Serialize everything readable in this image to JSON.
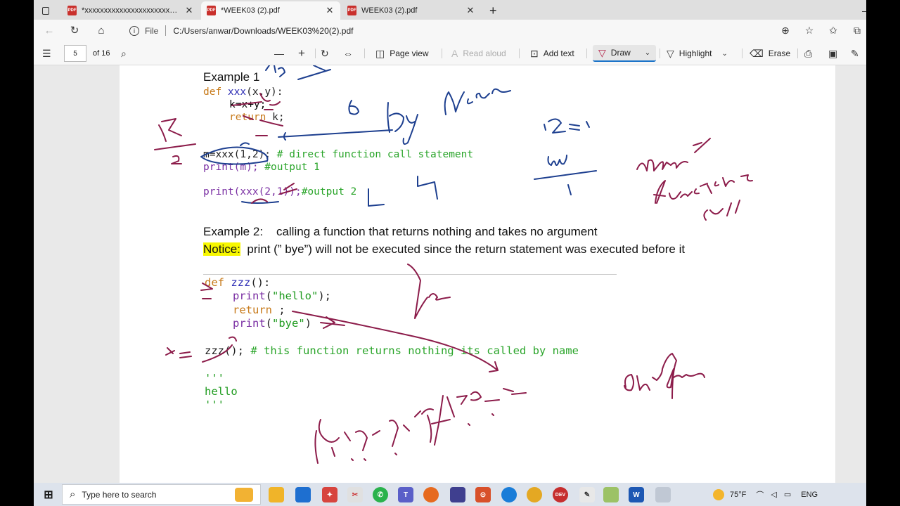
{
  "tabs": [
    {
      "title": "*xxxxxxxxxxxxxxxxxxxxxxxxxxxx.pdf",
      "icon": "pdf-icon",
      "active": false
    },
    {
      "title": "*WEEK03 (2).pdf",
      "icon": "pdf-icon",
      "active": true
    },
    {
      "title": "WEEK03 (2).pdf",
      "icon": "pdf-icon",
      "active": false
    }
  ],
  "address": {
    "file_label": "File",
    "url": "C:/Users/anwar/Downloads/WEEK03%20(2).pdf"
  },
  "toolbar": {
    "page_number": "5",
    "page_total": "of 16",
    "page_view": "Page view",
    "read_aloud": "Read aloud",
    "add_text": "Add text",
    "draw": "Draw",
    "highlight": "Highlight",
    "erase": "Erase"
  },
  "document": {
    "example1_title": "Example 1",
    "ex1_code": {
      "l1_def": "def",
      "l1_name": " xxx",
      "l1_rest": "(x,y):",
      "l2": "k=x+y;",
      "l3_kw": "return",
      "l3_rest": " k;",
      "l4_code": "m=xxx(1,2);",
      "l4_comment": " # direct function call statement",
      "l5_code": "print(m);",
      "l5_comment": " #output 1",
      "l6_code": "print(xxx(2,1));",
      "l6_comment": "#output 2"
    },
    "example2_title": "Example 2:",
    "example2_desc": "calling a function that returns nothing and takes no argument",
    "notice_label": "Notice:",
    "notice_text": "print (” bye”) will not be executed since the return statement was executed before it",
    "ex2_code": {
      "l1_def": "def",
      "l1_name": " zzz",
      "l1_rest": "():",
      "l2_print": "print",
      "l2_rest_a": "(",
      "l2_str": "\"hello\"",
      "l2_rest_b": ");",
      "l3_kw": "return",
      "l3_rest": " ;",
      "l4_print": "print",
      "l4_rest_a": "(",
      "l4_str": "\"bye\"",
      "l4_rest_b": ")",
      "l5_code": "zzz();",
      "l5_comment": " # this function returns nothing its called by name",
      "l6": "'''",
      "l7": "hello",
      "l8": "'''"
    }
  },
  "taskbar": {
    "search_placeholder": "Type here to search",
    "weather": "75°F",
    "language": "ENG"
  }
}
